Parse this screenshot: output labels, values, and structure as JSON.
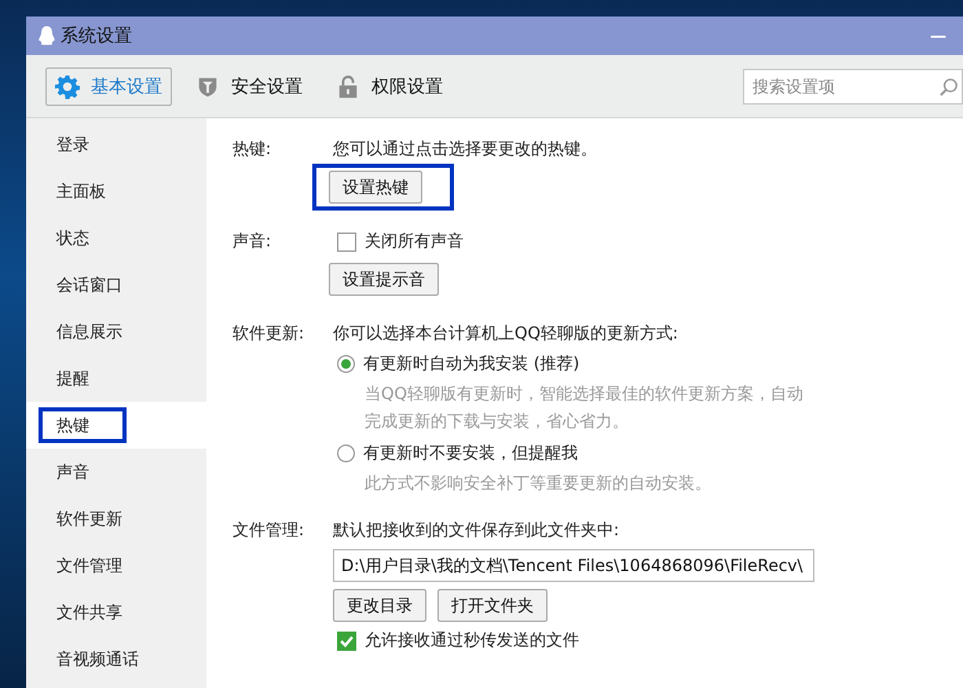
{
  "window": {
    "title": "系统设置",
    "minimize": "—"
  },
  "toolbar": {
    "tabs": [
      {
        "label": "基本设置",
        "kind": "gear",
        "selected": true
      },
      {
        "label": "安全设置",
        "kind": "shield",
        "selected": false
      },
      {
        "label": "权限设置",
        "kind": "lock",
        "selected": false
      }
    ],
    "search": {
      "placeholder": "搜索设置项"
    }
  },
  "sidebar": {
    "items": [
      {
        "label": "登录",
        "selected": false,
        "highlighted": false
      },
      {
        "label": "主面板",
        "selected": false,
        "highlighted": false
      },
      {
        "label": "状态",
        "selected": false,
        "highlighted": false
      },
      {
        "label": "会话窗口",
        "selected": false,
        "highlighted": false
      },
      {
        "label": "信息展示",
        "selected": false,
        "highlighted": false
      },
      {
        "label": "提醒",
        "selected": false,
        "highlighted": false
      },
      {
        "label": "热键",
        "selected": true,
        "highlighted": true
      },
      {
        "label": "声音",
        "selected": false,
        "highlighted": false
      },
      {
        "label": "软件更新",
        "selected": false,
        "highlighted": false
      },
      {
        "label": "文件管理",
        "selected": false,
        "highlighted": false
      },
      {
        "label": "文件共享",
        "selected": false,
        "highlighted": false
      },
      {
        "label": "音视频通话",
        "selected": false,
        "highlighted": false
      }
    ]
  },
  "sections": [
    {
      "label": "热键:",
      "items": [
        {
          "kind": "text",
          "text": "您可以通过点击选择要更改的热键。"
        },
        {
          "kind": "button",
          "label": "设置热键",
          "highlighted": true
        }
      ]
    },
    {
      "label": "声音:",
      "items": [
        {
          "kind": "checkbox",
          "label": "关闭所有声音",
          "checked": false
        },
        {
          "kind": "button",
          "label": "设置提示音",
          "highlighted": false
        }
      ]
    },
    {
      "label": "软件更新:",
      "items": [
        {
          "kind": "text",
          "text": "你可以选择本台计算机上QQ轻聊版的更新方式:"
        },
        {
          "kind": "radio",
          "label": "有更新时自动为我安装 (推荐)",
          "selected": true,
          "hint": "当QQ轻聊版有更新时，智能选择最佳的软件更新方案，自动完成更新的下载与安装，省心省力。"
        },
        {
          "kind": "radio",
          "label": "有更新时不要安装，但提醒我",
          "selected": false,
          "hint": "此方式不影响安全补丁等重要更新的自动安装。"
        }
      ]
    },
    {
      "label": "文件管理:",
      "items": [
        {
          "kind": "text",
          "text": "默认把接收到的文件保存到此文件夹中:"
        },
        {
          "kind": "field",
          "value": "D:\\用户目录\\我的文档\\Tencent Files\\1064868096\\FileRecv\\"
        },
        {
          "kind": "buttons",
          "labels": [
            "更改目录",
            "打开文件夹"
          ]
        },
        {
          "kind": "checkbox",
          "label": "允许接收通过秒传发送的文件",
          "checked": true
        }
      ]
    }
  ]
}
